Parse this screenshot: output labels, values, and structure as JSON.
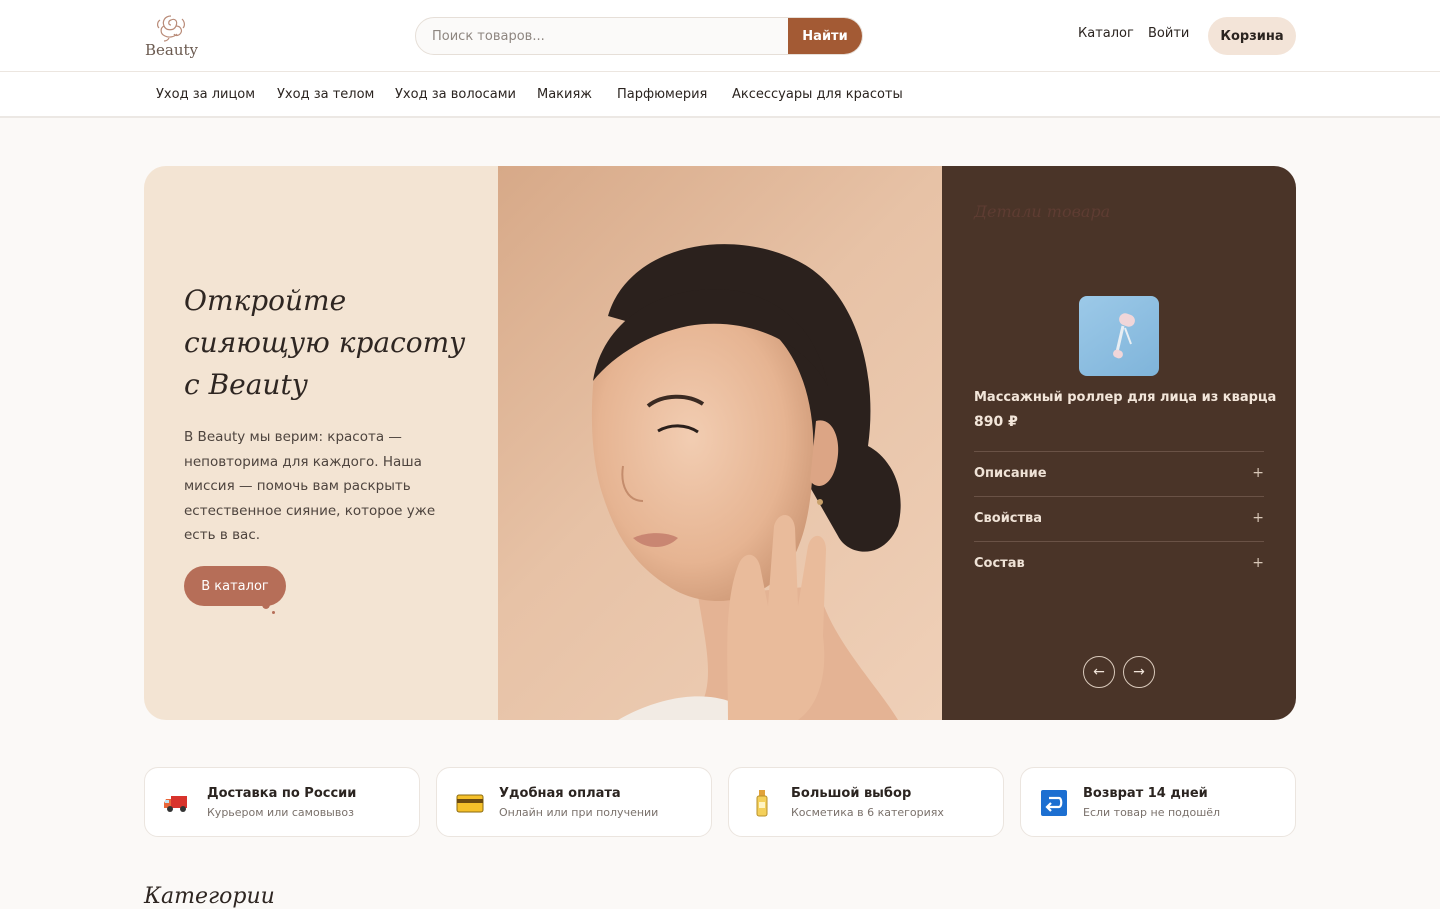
{
  "brand": {
    "name": "Beauty",
    "accent": "#a35a34"
  },
  "search": {
    "placeholder": "Поиск товаров...",
    "button": "Найти"
  },
  "topnav": {
    "catalog": "Каталог",
    "login": "Войти",
    "cart": "Корзина"
  },
  "categories": [
    "Уход за лицом",
    "Уход за телом",
    "Уход за волосами",
    "Макияж",
    "Парфюмерия",
    "Аксессуары для красоты"
  ],
  "hero": {
    "title_lines": [
      "Откройте",
      "сияющую красоту",
      "с Beauty"
    ],
    "text": "В Beauty мы верим: красота — неповторима для каждого. Наша миссия — помочь вам раскрыть естественное сияние, которое уже есть в вас.",
    "cta": "В каталог"
  },
  "product_panel": {
    "title": "Детали товара",
    "product_name": "Массажный роллер для лица из кварца",
    "price": "890 ₽",
    "accordion": [
      {
        "label": "Описание",
        "icon": "+"
      },
      {
        "label": "Свойства",
        "icon": "+"
      },
      {
        "label": "Состав",
        "icon": "+"
      }
    ],
    "prev": "←",
    "next": "→"
  },
  "features": [
    {
      "icon": "truck-icon",
      "title": "Доставка по России",
      "subtitle": "Курьером или самовывоз"
    },
    {
      "icon": "card-icon",
      "title": "Удобная оплата",
      "subtitle": "Онлайн или при получении"
    },
    {
      "icon": "bottle-icon",
      "title": "Большой выбор",
      "subtitle": "Косметика в 6 категориях"
    },
    {
      "icon": "return-icon",
      "title": "Возврат 14 дней",
      "subtitle": "Если товар не подошёл"
    }
  ],
  "sections": {
    "categories_title": "Категории"
  }
}
